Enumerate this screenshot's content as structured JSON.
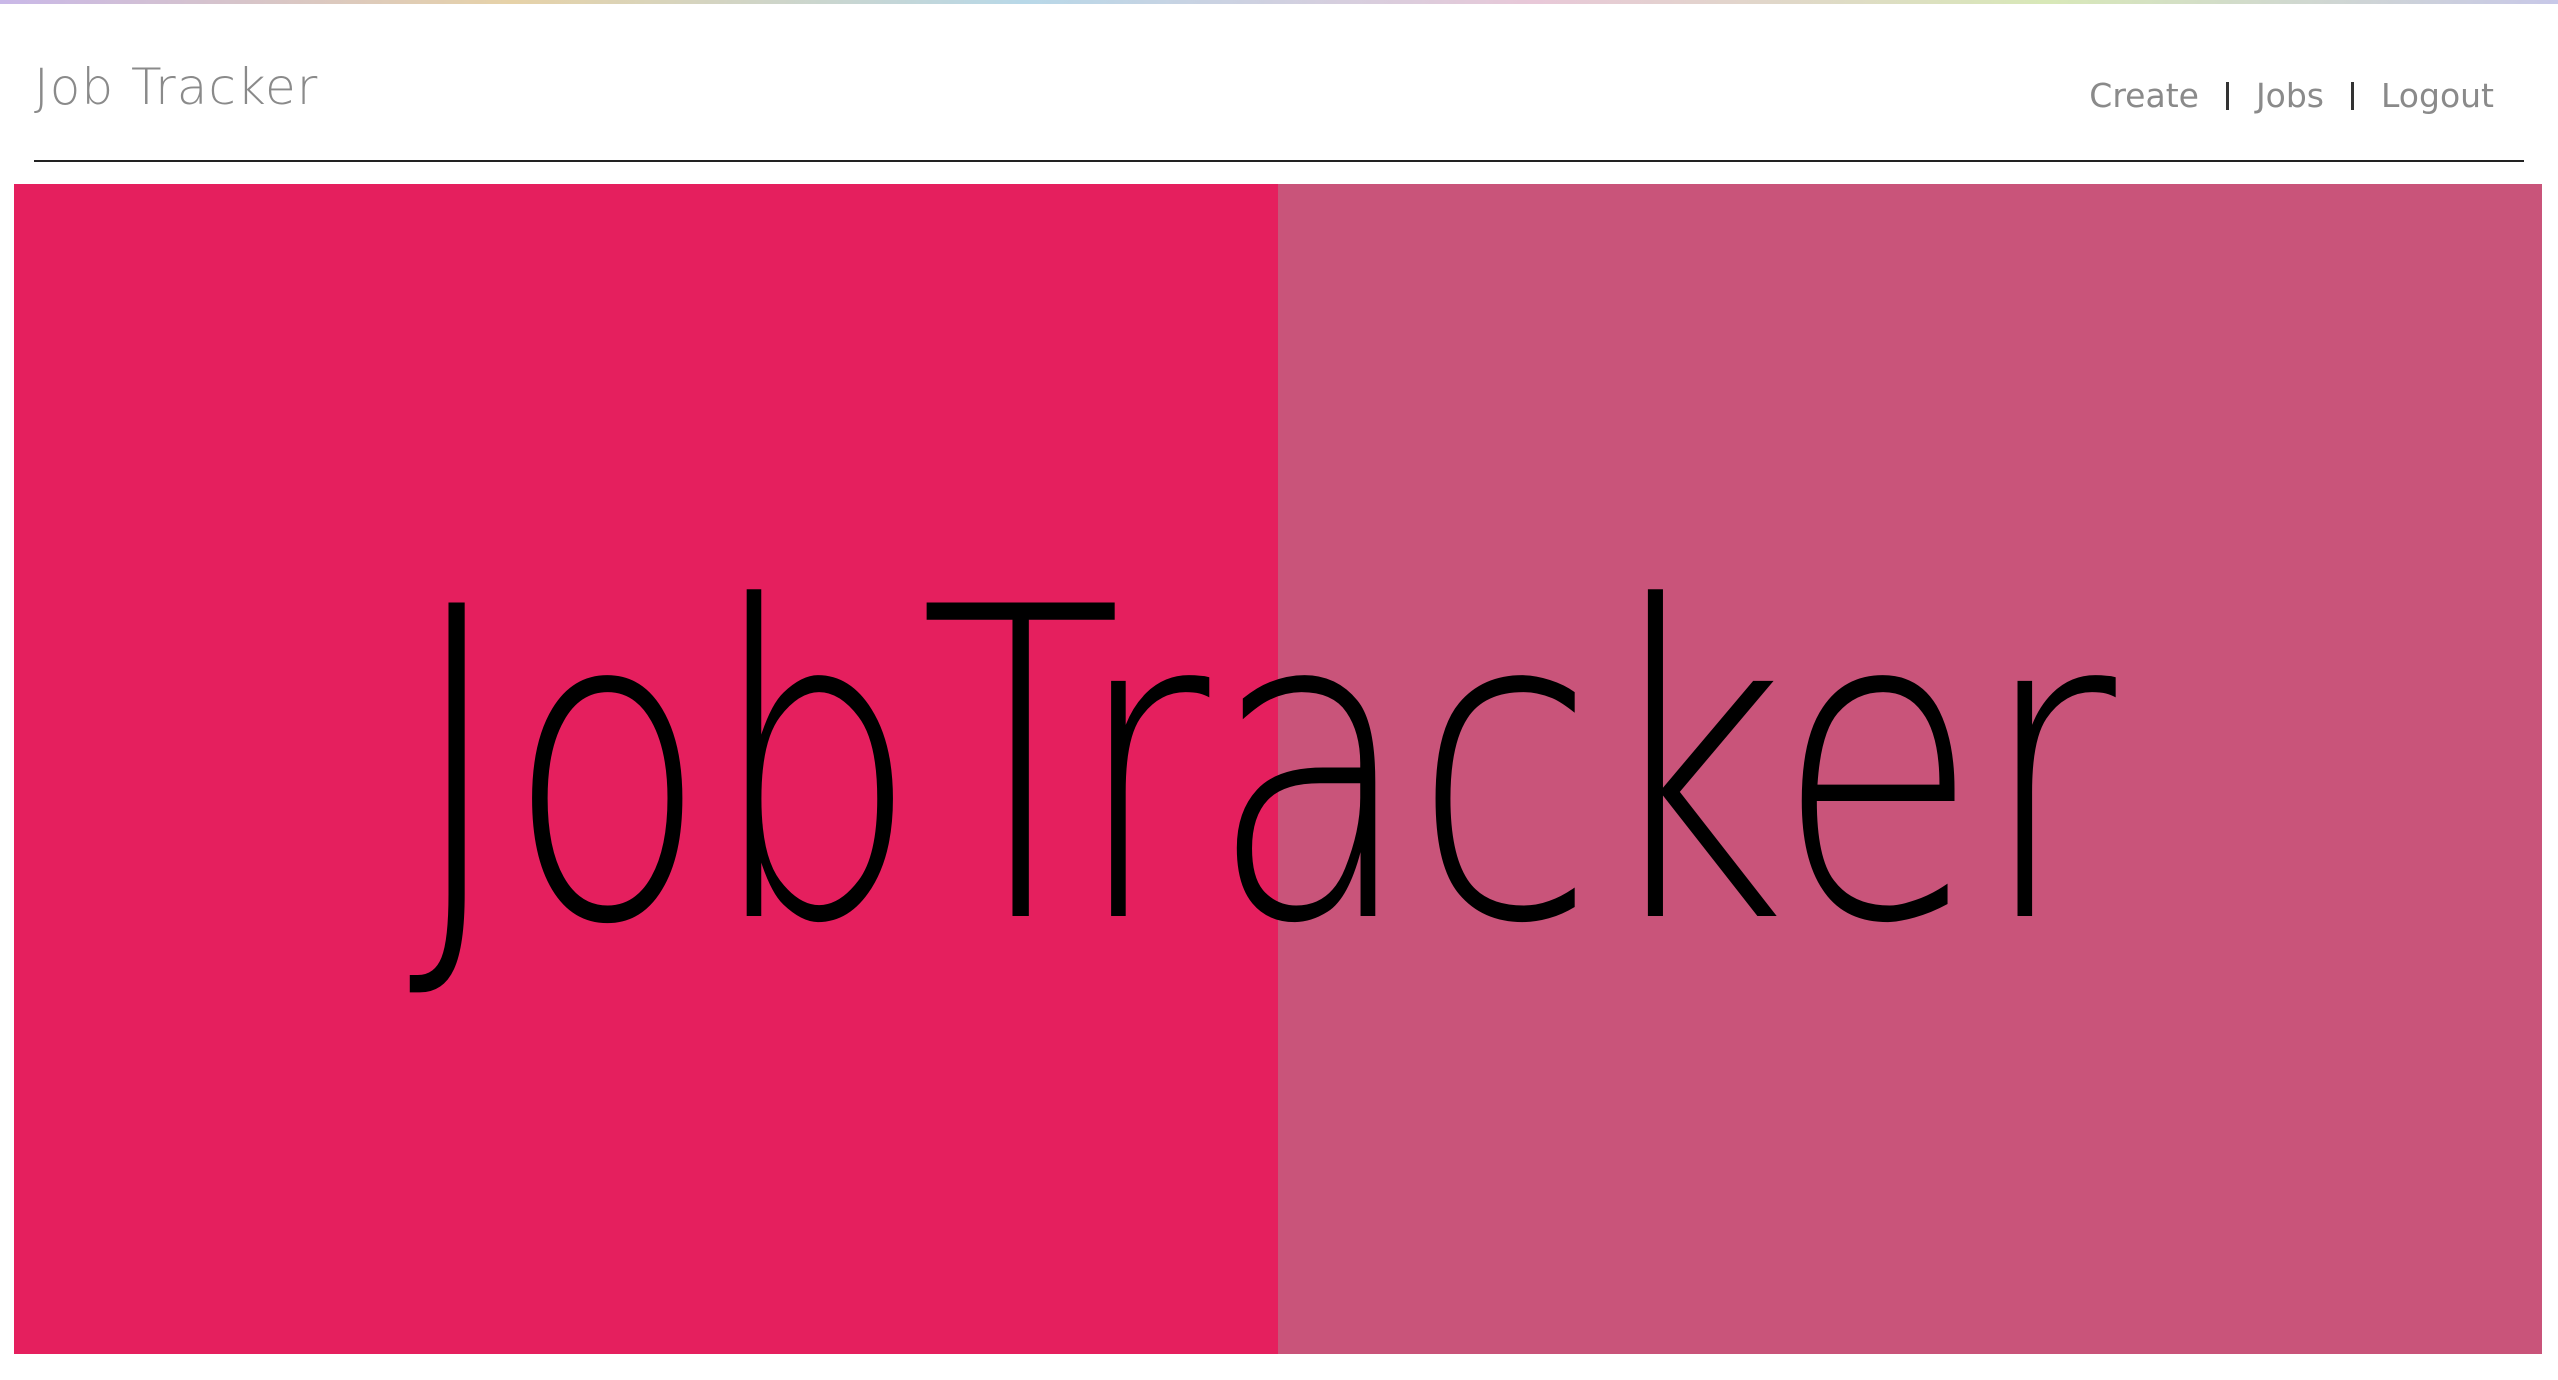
{
  "header": {
    "brand": "Job Tracker",
    "nav": [
      {
        "label": "Create"
      },
      {
        "label": "Jobs"
      },
      {
        "label": "Logout"
      }
    ]
  },
  "hero": {
    "logo_text": "JobTracker",
    "colors": {
      "left_panel": "#e51f5e",
      "right_panel": "#c9547a",
      "logo_ink": "#000000"
    }
  }
}
